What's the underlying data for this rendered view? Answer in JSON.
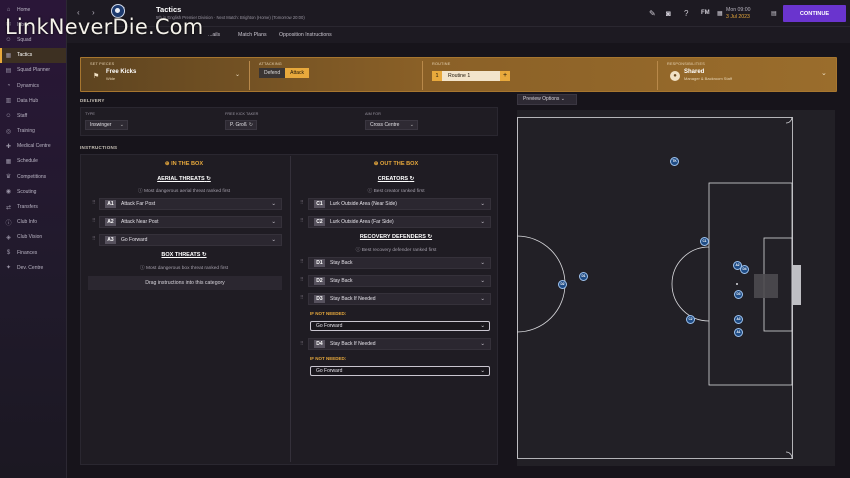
{
  "watermark": "LinkNeverDie.Com",
  "sidebar": {
    "items": [
      {
        "label": "Home",
        "icon": "home-icon"
      },
      {
        "label": "Inbox",
        "icon": "inbox-icon"
      },
      {
        "label": "Squad",
        "icon": "squad-icon"
      },
      {
        "label": "Tactics",
        "icon": "tactics-icon"
      },
      {
        "label": "Squad Planner",
        "icon": "planner-icon"
      },
      {
        "label": "Dynamics",
        "icon": "dynamics-icon"
      },
      {
        "label": "Data Hub",
        "icon": "data-hub-icon"
      },
      {
        "label": "Staff",
        "icon": "staff-icon"
      },
      {
        "label": "Training",
        "icon": "training-icon"
      },
      {
        "label": "Medical Centre",
        "icon": "medical-icon"
      },
      {
        "label": "Schedule",
        "icon": "schedule-icon"
      },
      {
        "label": "Competitions",
        "icon": "trophy-icon"
      },
      {
        "label": "Scouting",
        "icon": "scouting-icon"
      },
      {
        "label": "Transfers",
        "icon": "transfers-icon"
      },
      {
        "label": "Club Info",
        "icon": "club-info-icon"
      },
      {
        "label": "Club Vision",
        "icon": "club-vision-icon"
      },
      {
        "label": "Finances",
        "icon": "finances-icon"
      },
      {
        "label": "Dev. Centre",
        "icon": "dev-centre-icon"
      }
    ],
    "active_index": 3
  },
  "header": {
    "title": "Tactics",
    "subtitle": "5th in English Premier Division · Next Match: Brighton (Home) (Tomorrow 20:00)",
    "date_line1": "Mon 09:00",
    "date_line2": "3 Jul 2023",
    "fm_label": "FM",
    "continue_label": "CONTINUE",
    "accent_color": "#6a34ce"
  },
  "tabs": [
    {
      "label": "...ails"
    },
    {
      "label": "Match Plans"
    },
    {
      "label": "Opposition Instructions"
    }
  ],
  "setpiece": {
    "label": "SET PIECES",
    "value": "Free Kicks",
    "sub": "Wide",
    "attacking_label": "ATTACKING",
    "defend": "Defend",
    "attack": "Attack",
    "routine_label": "ROUTINE",
    "routine_num": "1",
    "routine_name": "Routine 1",
    "resp_label": "RESPONSIBILITIES",
    "resp_value": "Shared",
    "resp_sub": "Manager & Backroom Staff"
  },
  "delivery": {
    "heading": "DELIVERY",
    "type_label": "TYPE",
    "type_value": "Inswinger",
    "taker_label": "FREE KICK TAKER",
    "taker_value": "P. Groß",
    "aim_label": "AIM FOR",
    "aim_value": "Cross Centre"
  },
  "instructions": {
    "heading": "INSTRUCTIONS",
    "in_box": {
      "heading": "IN THE BOX",
      "aerial": {
        "title": "AERIAL THREATS",
        "hint": "Most dangerous aerial threat ranked first",
        "rows": [
          {
            "code": "A1",
            "text": "Attack Far Post"
          },
          {
            "code": "A2",
            "text": "Attack Near Post"
          },
          {
            "code": "A3",
            "text": "Go Forward"
          }
        ]
      },
      "box": {
        "title": "BOX THREATS",
        "hint": "Most dangerous box threat ranked first",
        "drag": "Drag instructions into this category"
      }
    },
    "out_box": {
      "heading": "OUT THE BOX",
      "creators": {
        "title": "CREATORS",
        "hint": "Best creator ranked first",
        "rows": [
          {
            "code": "C1",
            "text": "Lurk Outside Area (Near Side)"
          },
          {
            "code": "C2",
            "text": "Lurk Outside Area (Far Side)"
          }
        ]
      },
      "recovery": {
        "title": "RECOVERY DEFENDERS",
        "hint": "Best recovery defender ranked first",
        "rows": [
          {
            "code": "D1",
            "text": "Stay Back"
          },
          {
            "code": "D2",
            "text": "Stay Back"
          },
          {
            "code": "D3",
            "text": "Stay Back If Needed"
          },
          {
            "code": "D4",
            "text": "Stay Back If Needed"
          }
        ]
      },
      "if_not_needed": "IF NOT NEEDED:",
      "fallback_1": "Go Forward",
      "fallback_2": "Go Forward"
    }
  },
  "pitch": {
    "preview_label": "Preview Options",
    "players": [
      "TK",
      "C1",
      "D1",
      "D2",
      "C2",
      "A2",
      "D4",
      "D3",
      "A3",
      "A1"
    ]
  }
}
